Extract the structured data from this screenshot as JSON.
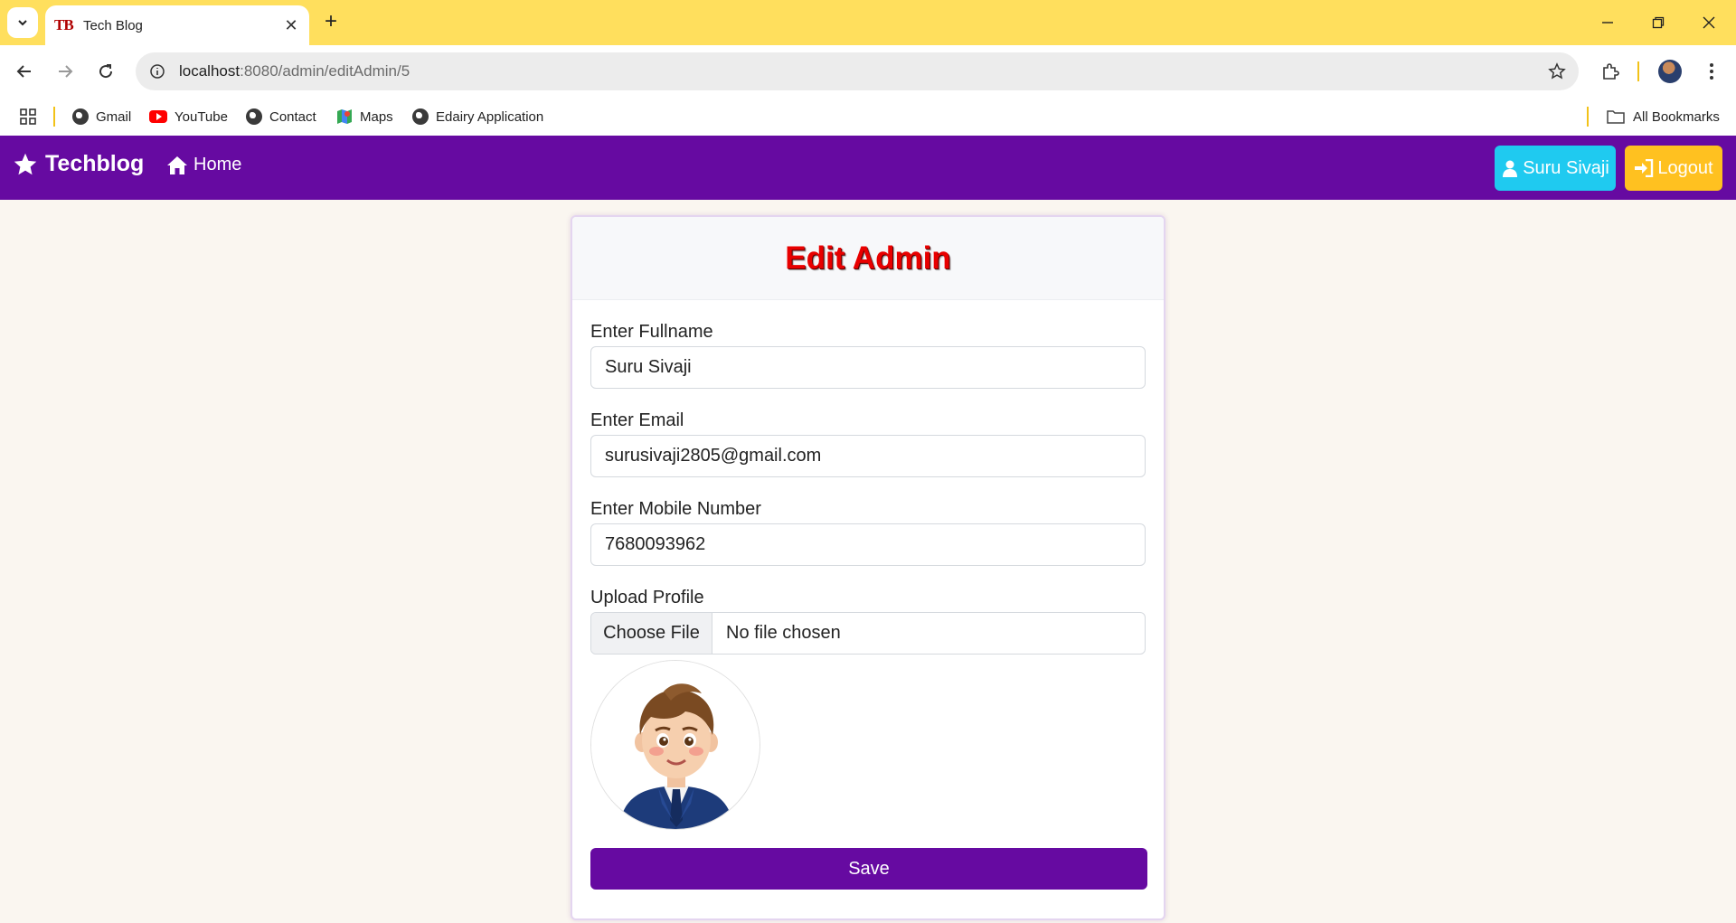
{
  "browser": {
    "tab_title": "Tech Blog",
    "tab_favicon_text": "TB",
    "url_host": "localhost",
    "url_path": ":8080/admin/editAdmin/5",
    "bookmarks": [
      {
        "label": "Gmail",
        "icon": "globe-icon"
      },
      {
        "label": "YouTube",
        "icon": "youtube-icon"
      },
      {
        "label": "Contact",
        "icon": "globe-icon"
      },
      {
        "label": "Maps",
        "icon": "maps-icon"
      },
      {
        "label": "Edairy Application",
        "icon": "globe-icon"
      }
    ],
    "all_bookmarks": "All Bookmarks"
  },
  "navbar": {
    "brand": "Techblog",
    "home": "Home",
    "user": "Suru Sivaji",
    "logout": "Logout",
    "color": "#660aa1"
  },
  "form": {
    "title": "Edit Admin",
    "fullname_label": "Enter Fullname",
    "fullname_value": "Suru Sivaji",
    "email_label": "Enter Email",
    "email_value": "surusivaji2805@gmail.com",
    "mobile_label": "Enter Mobile Number",
    "mobile_value": "7680093962",
    "upload_label": "Upload Profile",
    "choose_file": "Choose File",
    "no_file": "No file chosen",
    "save": "Save"
  }
}
